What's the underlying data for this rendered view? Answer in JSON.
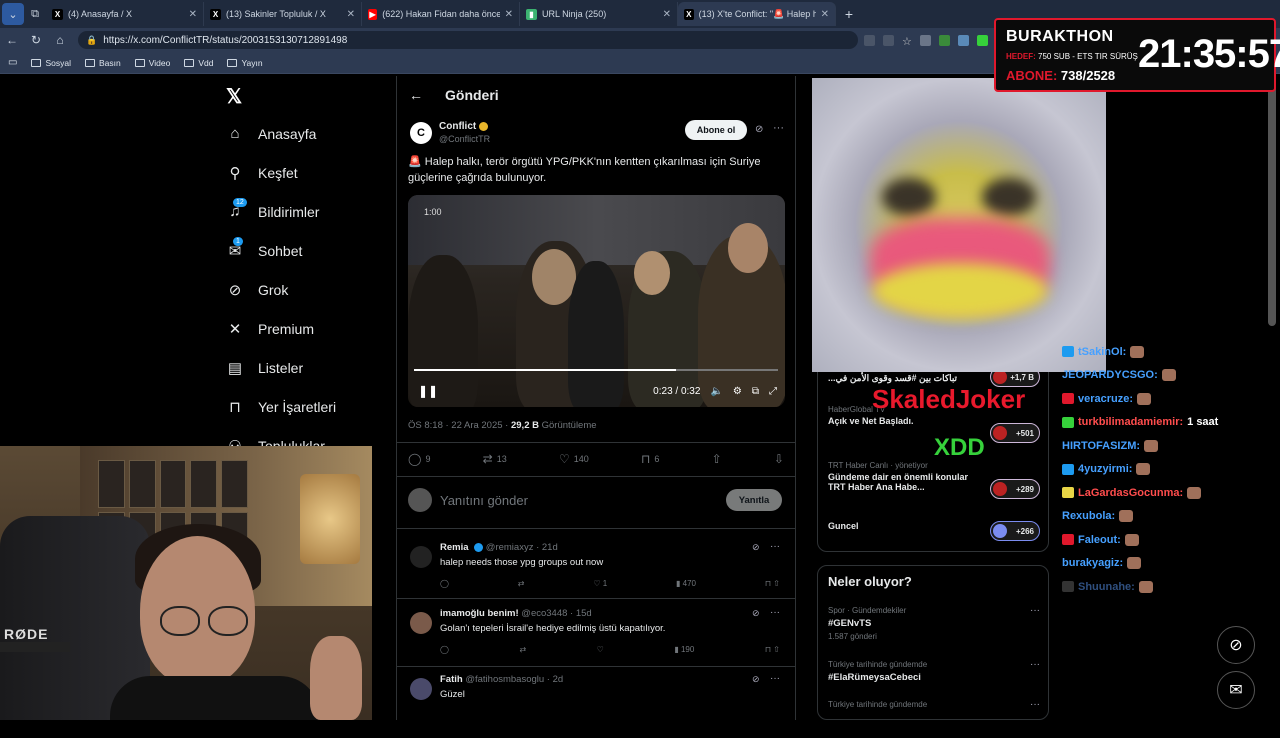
{
  "browser": {
    "tabs": [
      {
        "title": "(4) Anasayfa / X",
        "favicon": "X",
        "color": "#000000"
      },
      {
        "title": "(13) Sakinler Topluluk / X",
        "favicon": "X",
        "color": "#000000"
      },
      {
        "title": "(622) Hakan Fidan daha önce Şam",
        "favicon": "▶",
        "color": "#ff0000"
      },
      {
        "title": "URL Ninja (250)",
        "favicon": "▮",
        "color": "#3cb371"
      },
      {
        "title": "(13) X'te Conflict: \"🚨 Halep halkı",
        "favicon": "X",
        "color": "#000000"
      }
    ],
    "url": "https://x.com/ConflictTR/status/2003153130712891498",
    "bookmarks": [
      "Sosyal",
      "Basın",
      "Video",
      "Vdd",
      "Yayın"
    ]
  },
  "sidebar": {
    "items": [
      {
        "label": "Anasayfa",
        "icon": "home-icon",
        "glyph": "⌂"
      },
      {
        "label": "Keşfet",
        "icon": "search-icon",
        "glyph": "⚲"
      },
      {
        "label": "Bildirimler",
        "icon": "bell-icon",
        "glyph": "🔔",
        "badge": "12"
      },
      {
        "label": "Sohbet",
        "icon": "mail-icon",
        "glyph": "✉",
        "badge": "1"
      },
      {
        "label": "Grok",
        "icon": "grok-icon",
        "glyph": "⊘"
      },
      {
        "label": "Premium",
        "icon": "x-premium-icon",
        "glyph": "✕"
      },
      {
        "label": "Listeler",
        "icon": "list-icon",
        "glyph": "▤"
      },
      {
        "label": "Yer İşaretleri",
        "icon": "bookmark-icon",
        "glyph": "⊓"
      },
      {
        "label": "Topluluklar",
        "icon": "communities-icon",
        "glyph": "⚇"
      }
    ]
  },
  "post": {
    "header_title": "Gönderi",
    "author_name": "Conflict",
    "author_handle": "@ConflictTR",
    "follow_label": "Abone ol",
    "text": "🚨 Halep halkı, terör örgütü YPG/PKK'nın kentten çıkarılması için Suriye güçlerine çağrıda bulunuyor.",
    "video_duration": "1:00",
    "video_time": "0:23 / 0:32",
    "video_progress": 0.72,
    "time": "ÖS 8:18 · 22 Ara 2025 · ",
    "views": "29,2 B",
    "views_label": " Görüntüleme",
    "replies": "9",
    "reposts": "13",
    "likes": "140",
    "bookmarks": "6",
    "reply_placeholder": "Yanıtını gönder",
    "reply_button": "Yanıtla"
  },
  "comments": [
    {
      "name": "Remia",
      "handle": "@remiaxyz · 21d",
      "text": "halep needs those ypg groups out now",
      "likes": "1",
      "views": "470",
      "avatar_color": "#222222"
    },
    {
      "name": "imamoğlu benim!",
      "handle": "@eco3448 · 15d",
      "text": "Golan'ı tepeleri İsrail'e hediye edilmiş üstü kapatılıyor.",
      "likes": "",
      "views": "190",
      "avatar_color": "#7a5a4a"
    },
    {
      "name": "Fatih",
      "handle": "@fatihosmbasoglu · 2d",
      "text": "Güzel",
      "likes": "",
      "views": "",
      "avatar_color": "#4a4a6a"
    }
  ],
  "trends_box": [
    {
      "source": "",
      "text": "...تباكات بين #قسد وقوى الأمن في",
      "count": "+1,7 B"
    },
    {
      "source": "HaberGlobal TV",
      "text": "Açık ve Net Başladı.",
      "count": "+501"
    },
    {
      "source": "TRT Haber Canlı · yönetiyor",
      "text": "Gündeme dair en önemli konular TRT Haber Ana Habe...",
      "count": "+289"
    },
    {
      "source": "",
      "text": "Guncel",
      "count": "+266"
    }
  ],
  "neler": {
    "title": "Neler oluyor?",
    "items": [
      {
        "category": "Spor · Gündemdekiler",
        "tag": "#GENvTS",
        "posts": "1.587 gönderi"
      },
      {
        "category": "Türkiye tarihinde gündemde",
        "tag": "#ElaRümeysaCebeci",
        "posts": ""
      },
      {
        "category": "Türkiye tarihinde gündemde",
        "tag": "",
        "posts": ""
      }
    ]
  },
  "stream": {
    "title": "BURAKTHON",
    "hedef_label": "HEDEF:",
    "hedef_text": "750 SUB - ETS TIR SÜRÜŞ",
    "abone_label": "ABONE:",
    "abone_value": "738/2528",
    "clock": "21:35:57",
    "overlay_texts": [
      "SkaledJoker",
      "XDD"
    ],
    "webcam_logo": "RØDE"
  },
  "chat": [
    {
      "name": "tSakinOl:",
      "msg": "",
      "color": "#46a0ff",
      "icon": "#1d9bf0"
    },
    {
      "name": "JEOPARDYCSGO:",
      "msg": "",
      "color": "#46a0ff",
      "icon": ""
    },
    {
      "name": "veracruze:",
      "msg": "",
      "color": "#46a0ff",
      "icon": "#e0182c"
    },
    {
      "name": "turkbilimadamiemir:",
      "msg": "1 saat",
      "color": "#ff4d4d",
      "icon": "#36d13b"
    },
    {
      "name": "HIRTOFASIZM:",
      "msg": "",
      "color": "#46a0ff",
      "icon": ""
    },
    {
      "name": "4yuzyirmi:",
      "msg": "",
      "color": "#46a0ff",
      "icon": "#1d9bf0"
    },
    {
      "name": "LaGardasGocunma:",
      "msg": "",
      "color": "#ff4d4d",
      "icon": "#e8d546"
    },
    {
      "name": "Rexubola:",
      "msg": "",
      "color": "#46a0ff",
      "icon": ""
    },
    {
      "name": "Faleout:",
      "msg": "",
      "color": "#46a0ff",
      "icon": "#e0182c"
    },
    {
      "name": "burakyagiz:",
      "msg": "",
      "color": "#46a0ff",
      "icon": ""
    },
    {
      "name": "Shuunahe:",
      "msg": "",
      "color": "#2f4f7f",
      "icon": "#333333"
    }
  ]
}
